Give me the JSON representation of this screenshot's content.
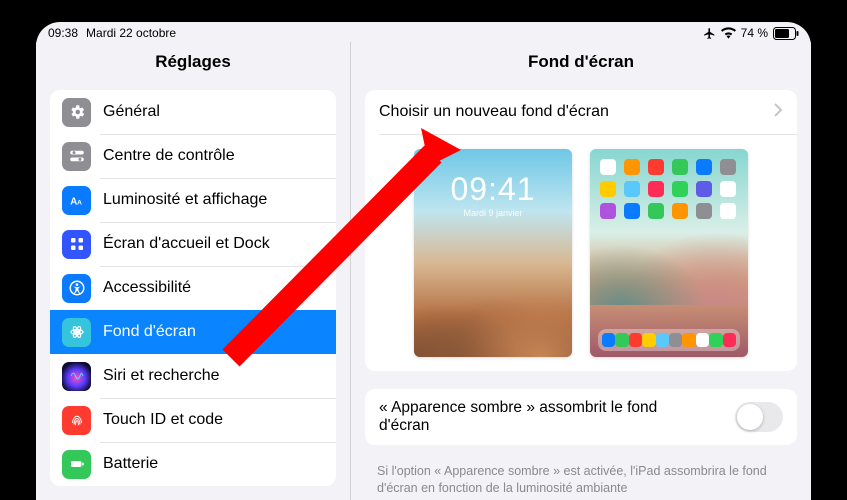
{
  "status": {
    "time": "09:38",
    "date": "Mardi 22 octobre",
    "battery_pct": "74 %"
  },
  "sidebar": {
    "title": "Réglages",
    "items": [
      {
        "label": "Général"
      },
      {
        "label": "Centre de contrôle"
      },
      {
        "label": "Luminosité et affichage"
      },
      {
        "label": "Écran d'accueil et Dock"
      },
      {
        "label": "Accessibilité"
      },
      {
        "label": "Fond d'écran"
      },
      {
        "label": "Siri et recherche"
      },
      {
        "label": "Touch ID et code"
      },
      {
        "label": "Batterie"
      }
    ],
    "selected_index": 5
  },
  "detail": {
    "title": "Fond d'écran",
    "choose_label": "Choisir un nouveau fond d'écran",
    "lock_preview": {
      "time": "09:41",
      "date": "Mardi 9 janvier"
    },
    "dark_toggle_label": "« Apparence sombre » assombrit le fond d'écran",
    "footer": "Si l'option « Apparence sombre » est activée, l'iPad assombrira le fond d'écran en fonction de la luminosité ambiante"
  },
  "home_icons": [
    "#ffffff",
    "#ff9500",
    "#ff3b30",
    "#34c759",
    "#0a7aff",
    "#8e8e93",
    "#ffcc00",
    "#5ac8fa",
    "#ff2d55",
    "#30d158",
    "#5e5ce6",
    "#ffffff",
    "#af52de",
    "#0a7aff",
    "#34c759",
    "#ff9500",
    "#8e8e93",
    "#ffffff"
  ],
  "dock_icons": [
    "#0a7aff",
    "#34c759",
    "#ff3b30",
    "#ffcc00",
    "#5ac8fa",
    "#8e8e93",
    "#ff9500",
    "#ffffff",
    "#30d158",
    "#ff2d55"
  ]
}
